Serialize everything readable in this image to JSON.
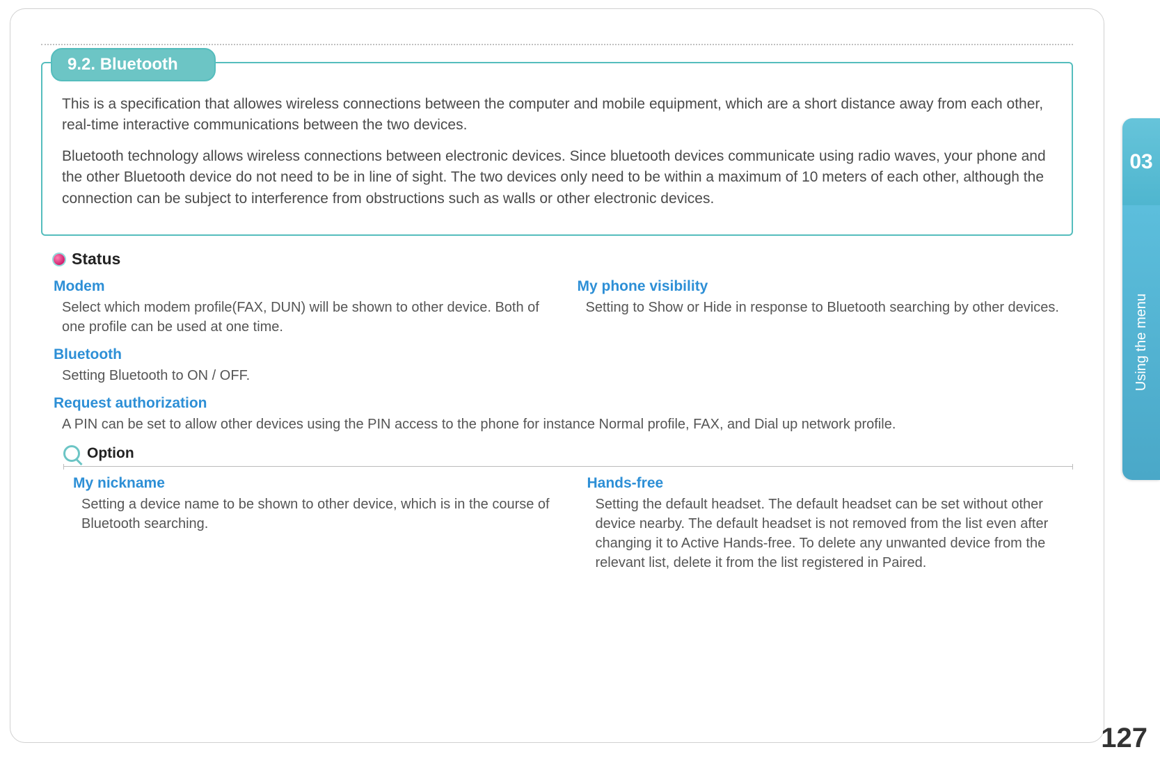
{
  "side_tab": {
    "chapter_number": "03",
    "chapter_title": "Using the menu"
  },
  "page_number": "127",
  "section": {
    "title": "9.2. Bluetooth",
    "intro_p1": "This is a specification that allowes wireless connections between the computer and mobile equipment, which are a short distance away from each other, real-time interactive communications between the two devices.",
    "intro_p2": "Bluetooth technology allows wireless connections between electronic devices. Since bluetooth devices communicate using radio waves, your phone and the other Bluetooth device do not need to be in line of sight. The two devices only need to be within a maximum of 10 meters of each other, although the connection can be subject to interference from obstructions such as walls or other electronic devices."
  },
  "status": {
    "heading": "Status",
    "modem": {
      "title": "Modem",
      "body": "Select which modem profile(FAX, DUN) will be shown to other device. Both of one profile can be used at one time."
    },
    "visibility": {
      "title": "My phone visibility",
      "body": "Setting to Show or Hide in response to Bluetooth searching by other devices."
    },
    "bluetooth": {
      "title": "Bluetooth",
      "body": "Setting Bluetooth to ON / OFF."
    },
    "request_auth": {
      "title": "Request authorization",
      "body": "A PIN can be set to allow other devices using the PIN access to the phone for instance Normal profile, FAX, and Dial up network profile."
    }
  },
  "option": {
    "heading": "Option",
    "nickname": {
      "title": "My nickname",
      "body": "Setting a device name to be shown to other device, which is in the course of Bluetooth searching."
    },
    "handsfree": {
      "title": "Hands-free",
      "body": "Setting the default headset. The default headset can be set without other device nearby. The default headset is not removed from the list even after changing it to Active Hands-free. To delete any unwanted device from the relevant list, delete it from the list registered in Paired."
    }
  }
}
